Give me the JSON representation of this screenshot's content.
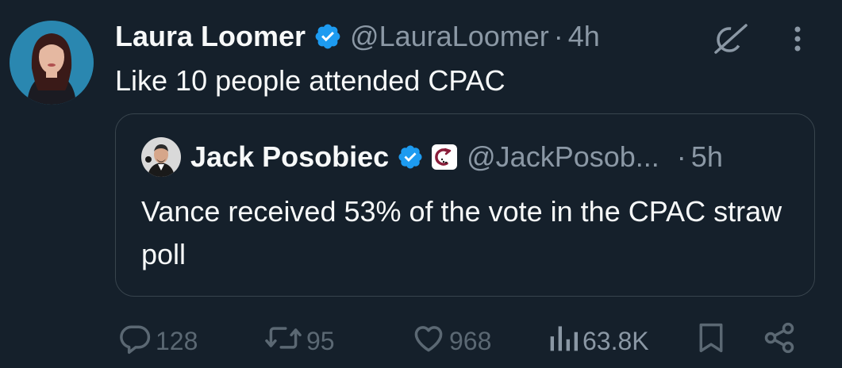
{
  "post": {
    "author_name": "Laura Loomer",
    "handle": "@LauraLoomer",
    "separator": "·",
    "time": "4h",
    "text": "Like 10 people attended CPAC"
  },
  "quoted": {
    "author_name": "Jack Posobiec",
    "handle": "@JackPosob...",
    "separator": "·",
    "time": "5h",
    "text": "Vance received 53% of the vote in the CPAC straw poll"
  },
  "actions": {
    "replies": "128",
    "reposts": "95",
    "likes": "968",
    "views": "63.8K"
  },
  "colors": {
    "background": "#15202b",
    "text": "#f7f9f9",
    "muted": "#8b98a5",
    "verified": "#1d9bf0",
    "border": "#38444d"
  },
  "icons": [
    "verified-badge-icon",
    "grok-icon",
    "more-icon",
    "affiliate-badge-icon",
    "reply-icon",
    "repost-icon",
    "like-icon",
    "views-icon",
    "bookmark-icon",
    "share-icon"
  ]
}
